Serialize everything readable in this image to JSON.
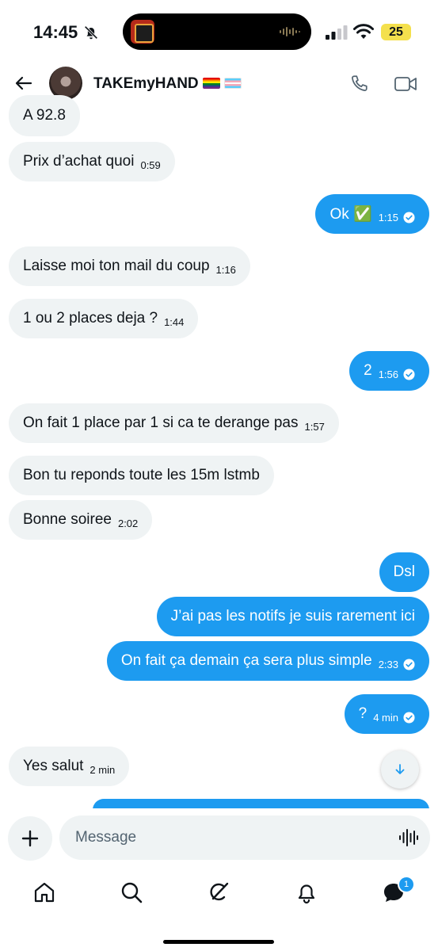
{
  "status_bar": {
    "time": "14:45",
    "battery": "25"
  },
  "header": {
    "contact_name": "TAKEmyHAND",
    "icons": [
      "back-arrow-icon",
      "phone-icon",
      "video-icon"
    ]
  },
  "messages": [
    {
      "direction": "incoming",
      "text": "A 92.8",
      "time": ""
    },
    {
      "direction": "incoming",
      "text": "Prix d’achat quoi",
      "time": "0:59"
    },
    {
      "direction": "outgoing",
      "text": "Ok ✅",
      "time": "1:15",
      "read": true
    },
    {
      "direction": "incoming",
      "text": "Laisse moi ton mail du coup",
      "time": "1:16"
    },
    {
      "direction": "incoming",
      "text": "1 ou 2 places deja ?",
      "time": "1:44"
    },
    {
      "direction": "outgoing",
      "text": "2",
      "time": "1:56",
      "read": true
    },
    {
      "direction": "incoming",
      "text": "On fait 1 place par 1 si ca te derange pas",
      "time": "1:57"
    },
    {
      "direction": "incoming",
      "text": "Bon tu reponds toute les 15m lstmb",
      "time": ""
    },
    {
      "direction": "incoming",
      "text": "Bonne soiree",
      "time": "2:02"
    },
    {
      "direction": "outgoing",
      "text": "Dsl",
      "time": ""
    },
    {
      "direction": "outgoing",
      "text": "J’ai pas les notifs je suis rarement ici",
      "time": ""
    },
    {
      "direction": "outgoing",
      "text": "On fait ça demain ça sera plus simple",
      "time": "2:33",
      "read": true
    },
    {
      "direction": "outgoing",
      "text": "?",
      "time": "4 min",
      "read": true
    },
    {
      "direction": "incoming",
      "text": "Yes salut",
      "time": "2 min"
    }
  ],
  "composer": {
    "placeholder": "Message"
  },
  "bottom_nav": {
    "items": [
      "home-icon",
      "search-icon",
      "grok-icon",
      "notifications-icon",
      "messages-icon"
    ],
    "messages_badge": "1"
  },
  "colors": {
    "accent": "#1d9bf0",
    "incoming_bubble": "#eff3f4"
  }
}
